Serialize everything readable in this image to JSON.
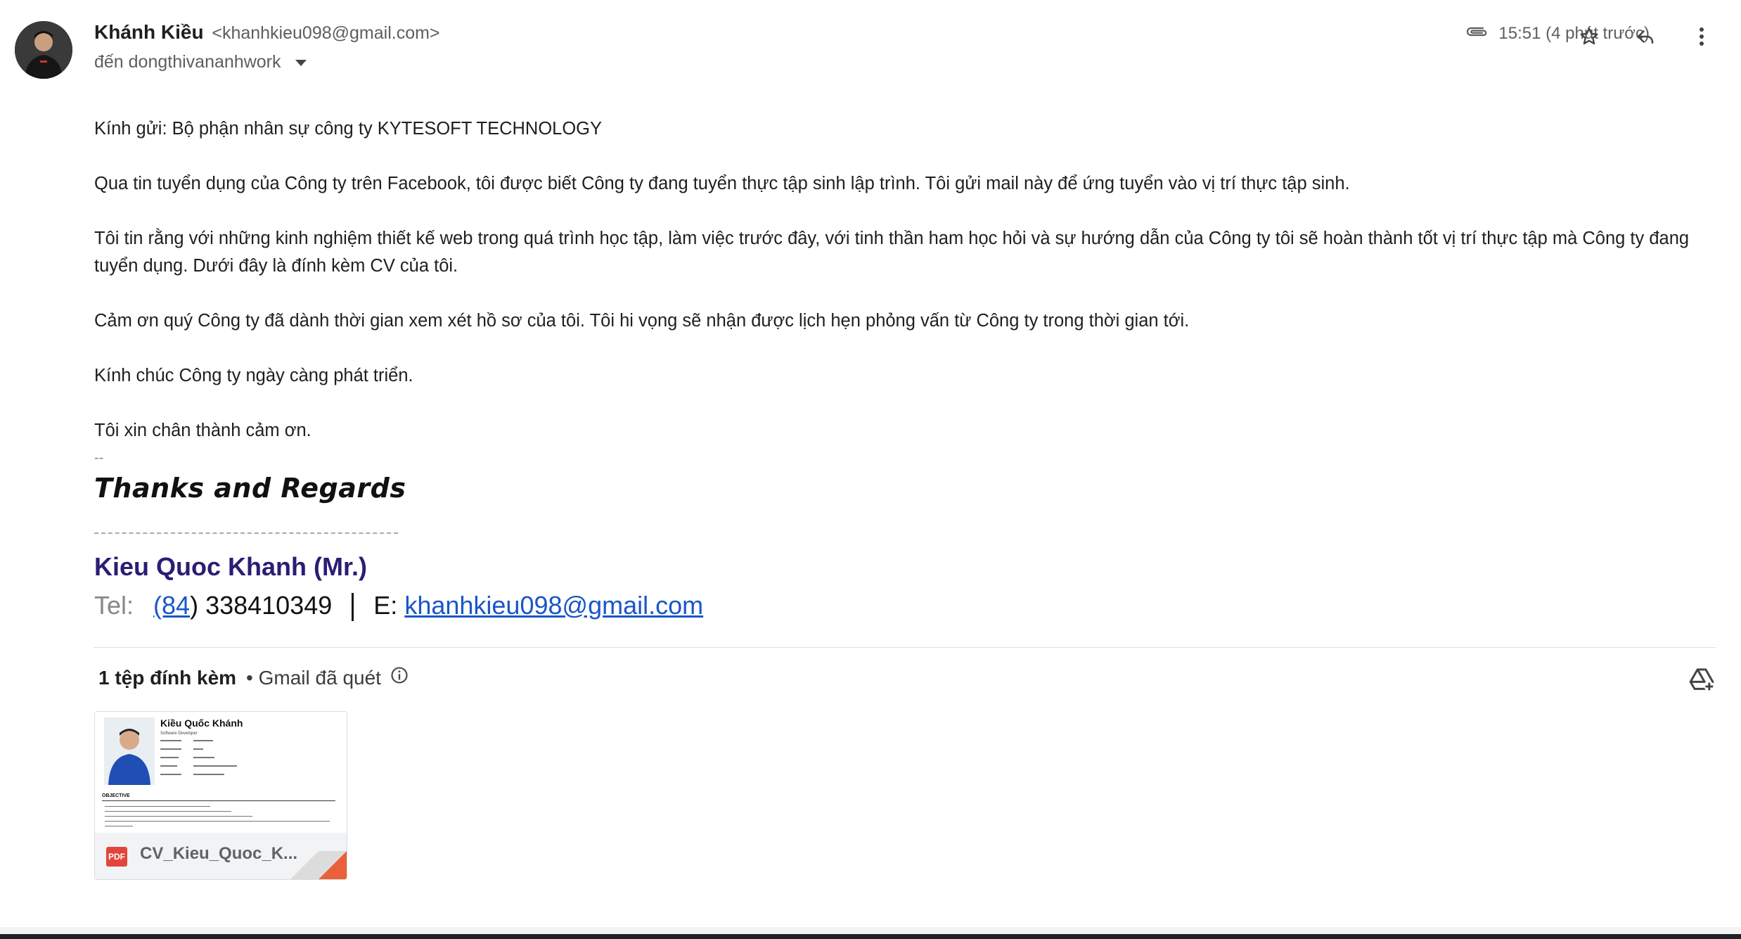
{
  "sender": {
    "name": "Khánh Kiều",
    "email": "<khanhkieu098@gmail.com>"
  },
  "recipient": {
    "label": "đến dongthivananhwork"
  },
  "meta": {
    "time": "15:51 (4 phút trước)"
  },
  "icons": {
    "attachment": "paperclip-icon",
    "star": "star-icon",
    "reply": "reply-icon",
    "more": "more-vert-icon",
    "info": "info-icon",
    "drive": "add-to-drive-icon",
    "pdf": "pdf-icon"
  },
  "body": {
    "p1": "Kính gửi: Bộ phận nhân sự công ty  KYTESOFT TECHNOLOGY",
    "p2": "Qua tin tuyển dụng của Công ty trên Facebook, tôi được biết Công ty đang tuyển thực tập sinh lập trình. Tôi gửi mail này để ứng tuyển vào vị trí thực tập sinh.",
    "p3": "Tôi tin rằng với những kinh nghiệm thiết kế web trong quá trình học tập, làm việc trước đây, với tinh thần ham học hỏi và sự hướng dẫn của Công ty tôi sẽ hoàn thành tốt vị trí thực tập mà Công ty đang tuyển dụng. Dưới đây là đính kèm CV của tôi.",
    "p4": "Cảm ơn quý Công ty đã dành thời gian xem xét hồ sơ của tôi. Tôi hi vọng sẽ nhận được lịch hẹn phỏng vấn từ Công ty trong thời gian tới.",
    "p5": "Kính chúc Công ty ngày càng phát triển.",
    "p6": "Tôi xin chân thành cảm ơn."
  },
  "signature": {
    "dash": "--",
    "thanks": "Thanks and Regards",
    "name": "Kieu Quoc Khanh (Mr.)",
    "tel_label": "Tel:",
    "tel_code": "(84",
    "tel_number": ") 338410349",
    "email_label": "E:",
    "email": "khanhkieu098@gmail.com"
  },
  "attachments": {
    "count": "1 tệp đính kèm",
    "scan": "• Gmail đã quét",
    "file": {
      "name": "CV_Kieu_Quoc_K...",
      "type": "PDF",
      "doc_title": "Kiều Quốc Khánh",
      "doc_role": "Software Developer",
      "doc_section": "OBJECTIVE"
    }
  },
  "colors": {
    "signature_name": "#2b1d74",
    "link": "#1a56c7",
    "pdf": "#e2453c"
  }
}
